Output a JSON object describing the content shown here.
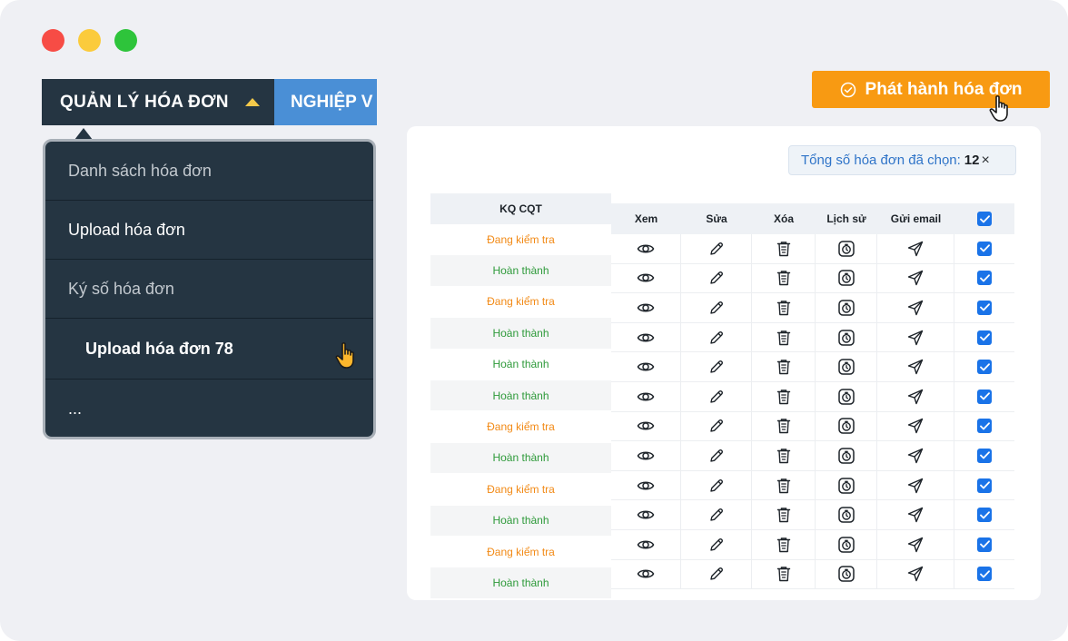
{
  "nav": {
    "active_tab": "QUẢN LÝ HÓA ĐƠN",
    "next_tab": "NGHIỆP V"
  },
  "dropdown": {
    "items": [
      {
        "label": "Danh sách hóa đơn"
      },
      {
        "label": "Upload hóa đơn"
      },
      {
        "label": "Ký số hóa đơn"
      },
      {
        "label": "Upload hóa đơn 78"
      },
      {
        "label": "..."
      }
    ]
  },
  "publish_button": {
    "label": "Phát hành hóa đơn"
  },
  "selection": {
    "label": "Tổng số hóa đơn đã chọn:",
    "count": "12",
    "clear": "×"
  },
  "table": {
    "status_header": "KQ CQT",
    "action_headers": {
      "view": "Xem",
      "edit": "Sửa",
      "delete": "Xóa",
      "history": "Lịch sử",
      "email": "Gửi email"
    },
    "rows": [
      {
        "status": "Đang kiểm tra"
      },
      {
        "status": "Hoàn thành"
      },
      {
        "status": "Đang kiểm tra"
      },
      {
        "status": "Hoàn thành"
      },
      {
        "status": "Hoàn thành"
      },
      {
        "status": "Hoàn thành"
      },
      {
        "status": "Đang kiểm tra"
      },
      {
        "status": "Hoàn thành"
      },
      {
        "status": "Đang kiểm tra"
      },
      {
        "status": "Hoàn thành"
      },
      {
        "status": "Đang kiểm tra"
      },
      {
        "status": "Hoàn thành"
      }
    ]
  },
  "colors": {
    "status_pending": "#f28a16",
    "status_done": "#2e9a3a",
    "accent": "#f89a12",
    "nav_dark": "#253542",
    "checkbox": "#1a73e8"
  }
}
